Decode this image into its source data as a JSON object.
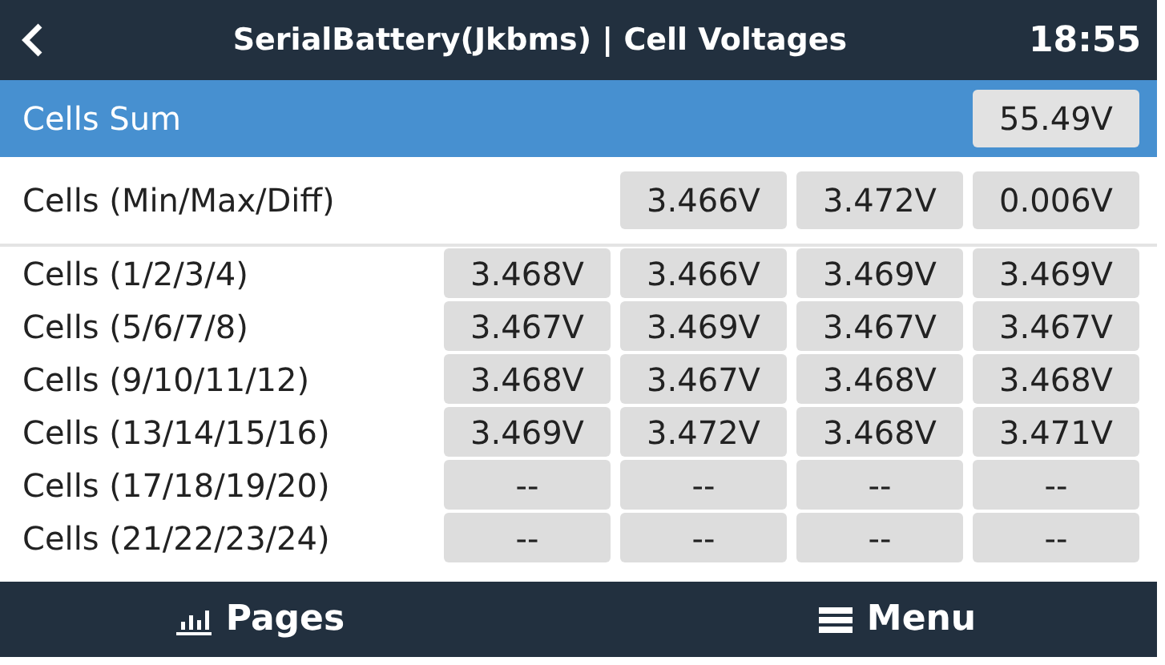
{
  "header": {
    "title": "SerialBattery(Jkbms) | Cell Voltages",
    "time": "18:55"
  },
  "items": [
    {
      "label": "Cells Sum",
      "values": [
        "55.49V"
      ],
      "selected": true
    },
    {
      "label": "Cells (Min/Max/Diff)",
      "values": [
        "3.466V",
        "3.472V",
        "0.006V"
      ],
      "selected": false
    },
    {
      "label": "Cells (1/2/3/4)",
      "values": [
        "3.468V",
        "3.466V",
        "3.469V",
        "3.469V"
      ],
      "selected": false
    },
    {
      "label": "Cells (5/6/7/8)",
      "values": [
        "3.467V",
        "3.469V",
        "3.467V",
        "3.467V"
      ],
      "selected": false
    },
    {
      "label": "Cells (9/10/11/12)",
      "values": [
        "3.468V",
        "3.467V",
        "3.468V",
        "3.468V"
      ],
      "selected": false
    },
    {
      "label": "Cells (13/14/15/16)",
      "values": [
        "3.469V",
        "3.472V",
        "3.468V",
        "3.471V"
      ],
      "selected": false
    },
    {
      "label": "Cells (17/18/19/20)",
      "values": [
        "--",
        "--",
        "--",
        "--"
      ],
      "selected": false
    },
    {
      "label": "Cells (21/22/23/24)",
      "values": [
        "--",
        "--",
        "--",
        "--"
      ],
      "selected": false
    }
  ],
  "footer": {
    "pages": "Pages",
    "menu": "Menu"
  }
}
